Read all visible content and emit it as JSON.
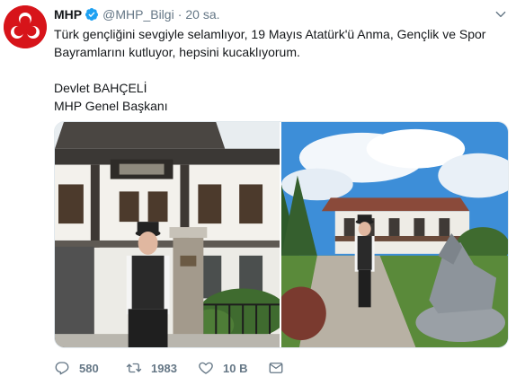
{
  "tweet": {
    "display_name": "MHP",
    "handle": "@MHP_Bilgi",
    "separator": "·",
    "time": "20 sa.",
    "text_line1": "Türk gençliğini sevgiyle selamlıyor, 19 Mayıs Atatürk'ü Anma, Gençlik ve Spor",
    "text_line2": "Bayramlarını kutluyor, hepsini kucaklıyorum.",
    "signature_name": "Devlet BAHÇELİ",
    "signature_title": "MHP Genel Başkanı"
  },
  "icons": {
    "avatar": "party-logo-icon",
    "verified": "verified-badge-icon",
    "more": "chevron-down-icon",
    "reply": "reply-icon",
    "retweet": "retweet-icon",
    "like": "heart-icon",
    "message": "envelope-icon"
  },
  "actions": {
    "reply_count": "580",
    "retweet_count": "1983",
    "like_count": "10 B"
  },
  "colors": {
    "brand_red": "#d7141a",
    "verified_blue": "#1da1f2",
    "muted": "#657786",
    "text": "#14171a"
  }
}
